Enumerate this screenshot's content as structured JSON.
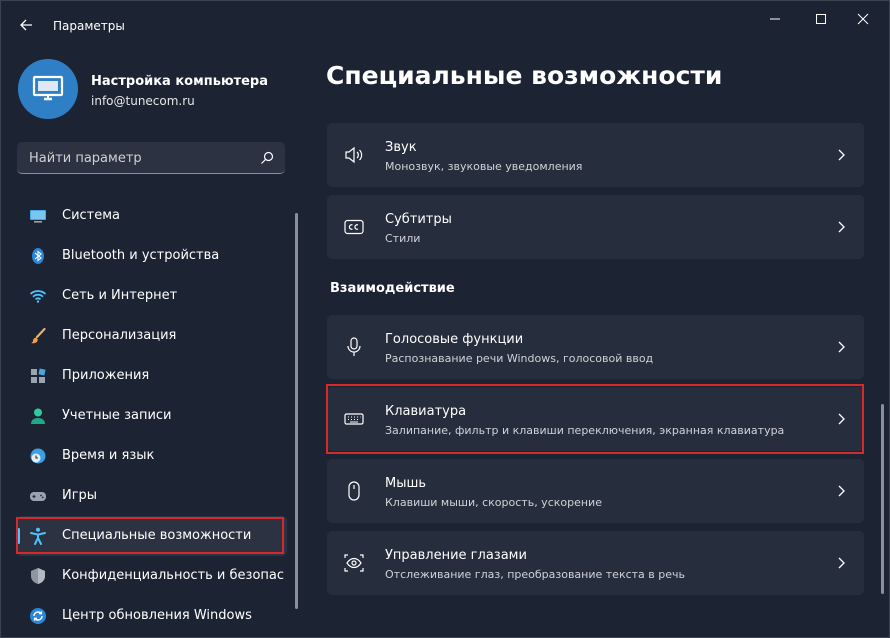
{
  "window": {
    "title": "Параметры"
  },
  "user": {
    "name": "Настройка компьютера",
    "email": "info@tunecom.ru"
  },
  "search": {
    "placeholder": "Найти параметр"
  },
  "sidebar": {
    "items": [
      {
        "label": "Система",
        "icon": "monitor-icon"
      },
      {
        "label": "Bluetooth и устройства",
        "icon": "bluetooth-icon"
      },
      {
        "label": "Сеть и Интернет",
        "icon": "wifi-icon"
      },
      {
        "label": "Персонализация",
        "icon": "brush-icon"
      },
      {
        "label": "Приложения",
        "icon": "apps-icon"
      },
      {
        "label": "Учетные записи",
        "icon": "person-icon"
      },
      {
        "label": "Время и язык",
        "icon": "globe-clock-icon"
      },
      {
        "label": "Игры",
        "icon": "gamepad-icon"
      },
      {
        "label": "Специальные возможности",
        "icon": "accessibility-icon",
        "selected": true
      },
      {
        "label": "Конфиденциальность и безопас",
        "icon": "shield-icon"
      },
      {
        "label": "Центр обновления Windows",
        "icon": "update-icon"
      }
    ]
  },
  "main": {
    "title": "Специальные возможности",
    "cards_top": [
      {
        "title": "Звук",
        "subtitle": "Монозвук, звуковые уведомления",
        "icon": "speaker-icon"
      },
      {
        "title": "Субтитры",
        "subtitle": "Стили",
        "icon": "captions-icon"
      }
    ],
    "section_title": "Взаимодействие",
    "cards_interaction": [
      {
        "title": "Голосовые функции",
        "subtitle": "Распознавание речи Windows, голосовой ввод",
        "icon": "microphone-icon"
      },
      {
        "title": "Клавиатура",
        "subtitle": "Залипание, фильтр и клавиши переключения, экранная клавиатура",
        "icon": "keyboard-icon"
      },
      {
        "title": "Мышь",
        "subtitle": "Клавиши мыши, скорость, ускорение",
        "icon": "mouse-icon"
      },
      {
        "title": "Управление глазами",
        "subtitle": "Отслеживание глаз, преобразование текста в речь",
        "icon": "eye-control-icon"
      }
    ]
  },
  "colors": {
    "accent": "#4cc2ff",
    "highlight": "#d42a2a",
    "background": "#1c2333",
    "card": "#262d3c"
  }
}
